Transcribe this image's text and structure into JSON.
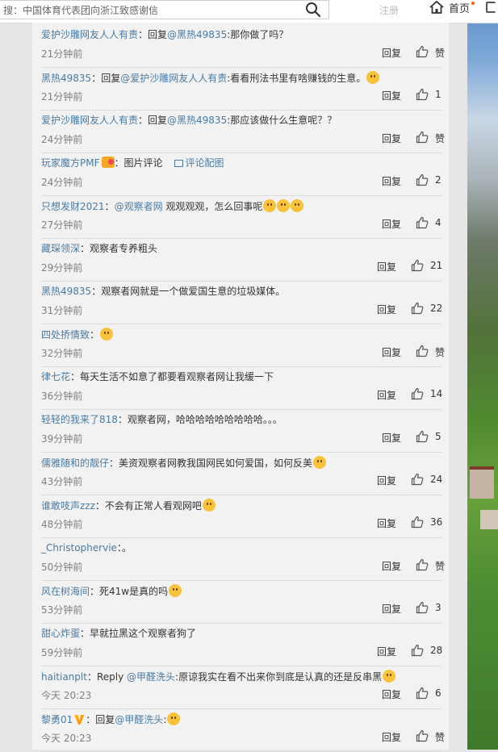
{
  "search": {
    "value": "搜：中国体育代表团向浙江致感谢信"
  },
  "nav": {
    "faded_label": "注册",
    "home_label": "首页"
  },
  "comments": [
    {
      "segments": [
        {
          "t": "爱护沙雕网友人人有责",
          "c": "user"
        },
        {
          "t": "：回复"
        },
        {
          "t": "@黑热49835",
          "c": "mention"
        },
        {
          "t": ":那你做了吗？"
        }
      ],
      "time": "21分钟前",
      "reply": "回复",
      "likes": "赞"
    },
    {
      "segments": [
        {
          "t": "黑热49835",
          "c": "user"
        },
        {
          "t": "：回复"
        },
        {
          "t": "@爱护沙雕网友人人有责",
          "c": "mention"
        },
        {
          "t": ":看看刑法书里有啥赚钱的生意。"
        },
        {
          "e": "smirk-emoji"
        }
      ],
      "time": "21分钟前",
      "reply": "回复",
      "likes": "1"
    },
    {
      "segments": [
        {
          "t": "爱护沙雕网友人人有责",
          "c": "user"
        },
        {
          "t": "：回复"
        },
        {
          "t": "@黑热49835",
          "c": "mention"
        },
        {
          "t": ":那应该做什么生意呢？？"
        }
      ],
      "time": "24分钟前",
      "reply": "回复",
      "likes": "赞"
    },
    {
      "segments": [
        {
          "t": "玩家魔方PMF",
          "c": "user"
        },
        {
          "b": "member-badge-icon"
        },
        {
          "t": "：图片评论"
        },
        {
          "i": "image-icon"
        },
        {
          "t": "评论配图",
          "c": "mention"
        }
      ],
      "time": "24分钟前",
      "reply": "回复",
      "likes": "2"
    },
    {
      "segments": [
        {
          "t": "只想发财2021",
          "c": "user"
        },
        {
          "t": "："
        },
        {
          "t": "@观察者网",
          "c": "mention"
        },
        {
          "t": " 观观观观，怎么回事呢"
        },
        {
          "e": "frown-emoji"
        },
        {
          "e": "frown-emoji"
        },
        {
          "e": "frown-emoji"
        }
      ],
      "time": "27分钟前",
      "reply": "回复",
      "likes": "4"
    },
    {
      "segments": [
        {
          "t": "藏琛领深",
          "c": "user"
        },
        {
          "t": "：观察者专养粗头"
        }
      ],
      "time": "29分钟前",
      "reply": "回复",
      "likes": "21"
    },
    {
      "segments": [
        {
          "t": "黑热49835",
          "c": "user"
        },
        {
          "t": "：观察者网就是一个做爱国生意的垃圾媒体。"
        }
      ],
      "time": "31分钟前",
      "reply": "回复",
      "likes": "22"
    },
    {
      "segments": [
        {
          "t": "四处挢情致",
          "c": "user"
        },
        {
          "t": "："
        },
        {
          "e": "thinking-emoji"
        }
      ],
      "time": "32分钟前",
      "reply": "回复",
      "likes": "赞"
    },
    {
      "segments": [
        {
          "t": "律七花",
          "c": "user"
        },
        {
          "t": "：每天生活不如意了都要看观察者网让我缓一下"
        }
      ],
      "time": "36分钟前",
      "reply": "回复",
      "likes": "14"
    },
    {
      "segments": [
        {
          "t": "轻轻的我来了818",
          "c": "user"
        },
        {
          "t": "：观察者网，哈哈哈哈哈哈哈哈哈。。。"
        }
      ],
      "time": "39分钟前",
      "reply": "回复",
      "likes": "5"
    },
    {
      "segments": [
        {
          "t": "儒雅随和的靓仔",
          "c": "user"
        },
        {
          "t": "：美资观察者网教我国网民如何爱国，如何反美"
        },
        {
          "e": "doge-emoji"
        }
      ],
      "time": "43分钟前",
      "reply": "回复",
      "likes": "24"
    },
    {
      "segments": [
        {
          "t": "谁敢吱声zzz",
          "c": "user"
        },
        {
          "t": "：不会有正常人看观网吧"
        },
        {
          "e": "smile-emoji"
        }
      ],
      "time": "48分钟前",
      "reply": "回复",
      "likes": "36"
    },
    {
      "segments": [
        {
          "t": "_Christophervie",
          "c": "user"
        },
        {
          "t": "：。"
        }
      ],
      "time": "50分钟前",
      "reply": "回复",
      "likes": "赞"
    },
    {
      "segments": [
        {
          "t": "风在树海间",
          "c": "user"
        },
        {
          "t": "：死41w是真的吗"
        },
        {
          "e": "smug-emoji"
        }
      ],
      "time": "53分钟前",
      "reply": "回复",
      "likes": "3"
    },
    {
      "segments": [
        {
          "t": "甜心炸蛋",
          "c": "user"
        },
        {
          "t": "：早就拉黑这个观察者狗了"
        }
      ],
      "time": "59分钟前",
      "reply": "回复",
      "likes": "28"
    },
    {
      "segments": [
        {
          "t": "haitianplt",
          "c": "user"
        },
        {
          "t": "：Reply "
        },
        {
          "t": "@甲醛洗头",
          "c": "mention"
        },
        {
          "t": ":原谅我实在看不出来你到底是认真的还是反串黑"
        },
        {
          "e": "facepalm-emoji"
        }
      ],
      "time": "今天 20:23",
      "reply": "回复",
      "likes": "6"
    },
    {
      "segments": [
        {
          "t": "黎勇01",
          "c": "user"
        },
        {
          "v": "vip-icon"
        },
        {
          "t": "：回复"
        },
        {
          "t": "@甲醛洗头",
          "c": "mention"
        },
        {
          "t": ":"
        },
        {
          "e": "laugh-emoji"
        }
      ],
      "time": "今天 20:23",
      "reply": "回复",
      "likes": "赞"
    }
  ]
}
